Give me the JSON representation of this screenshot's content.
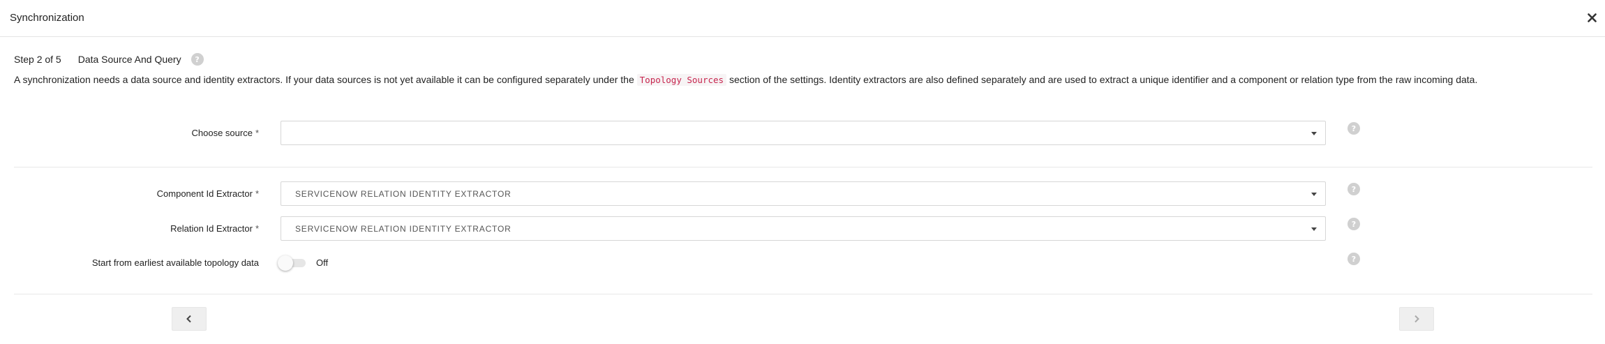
{
  "modal": {
    "title": "Synchronization",
    "close_icon": "close-icon"
  },
  "step": {
    "indicator": "Step 2 of 5",
    "title": "Data Source And Query",
    "help_icon": "?"
  },
  "description": {
    "before": "A synchronization needs a data source and identity extractors. If your data sources is not yet available it can be configured separately under the ",
    "code": "Topology Sources",
    "after": " section of the settings. Identity extractors are also defined separately and are used to extract a unique identifier and a component or relation type from the raw incoming data."
  },
  "form": {
    "required_mark": "*",
    "help_icon": "?",
    "source": {
      "label": "Choose source",
      "value": ""
    },
    "component_extractor": {
      "label": "Component Id Extractor",
      "value": "SERVICENOW RELATION IDENTITY EXTRACTOR"
    },
    "relation_extractor": {
      "label": "Relation Id Extractor",
      "value": "SERVICENOW RELATION IDENTITY EXTRACTOR"
    },
    "earliest": {
      "label": "Start from earliest available topology data",
      "state": "Off",
      "enabled": false
    }
  },
  "nav": {
    "prev_icon": "chevron-left-icon",
    "next_icon": "chevron-right-icon"
  },
  "colors": {
    "code_text": "#c7254e",
    "help_icon_bg": "#d0d0d0",
    "nav_bg": "#efefef"
  }
}
